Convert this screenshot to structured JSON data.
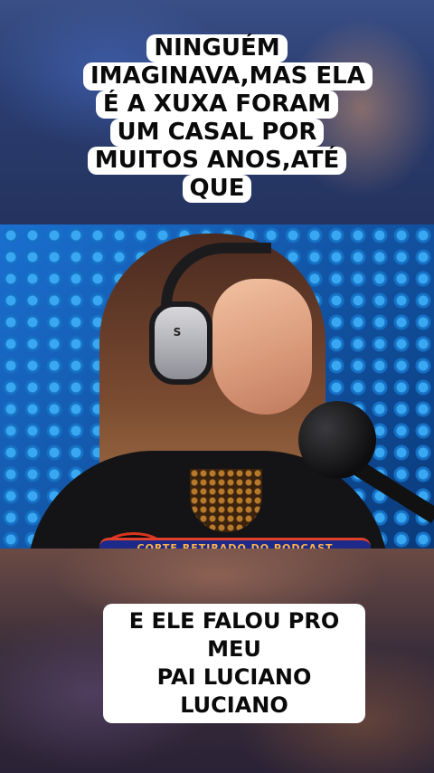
{
  "caption_top": {
    "lines": [
      "NINGUÉM",
      "IMAGINAVA,MAS ELA",
      "É A XUXA FORAM",
      "UM CASAL POR",
      "MUITOS ANOS,ATÉ",
      "QUE"
    ]
  },
  "video": {
    "banner_text": "CORTE RETIRADO DO PODCAST",
    "headphone_brand_glyph": "S"
  },
  "caption_bottom": {
    "lines": [
      "E ELE FALOU PRO MEU",
      "PAI LUCIANO LUCIANO"
    ]
  },
  "colors": {
    "caption_bg": "#ffffff",
    "caption_text": "#0a0a0a",
    "video_backdrop": "#1670c4",
    "banner_bg": "#1d2a8a",
    "banner_accent": "#e0402a"
  }
}
